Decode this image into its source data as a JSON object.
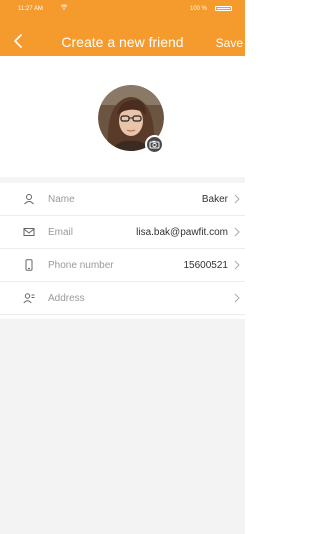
{
  "status_bar": {
    "time": "11:27 AM",
    "battery_text": "100 %"
  },
  "navbar": {
    "back_icon": "chevron-left-icon",
    "title": "Create a new friend",
    "save_label": "Save"
  },
  "avatar": {
    "camera_icon": "camera-icon"
  },
  "form": {
    "rows": [
      {
        "icon": "person-icon",
        "label": "Name",
        "value": "Baker"
      },
      {
        "icon": "mail-icon",
        "label": "Email",
        "value": "lisa.bak@pawfit.com"
      },
      {
        "icon": "phone-icon",
        "label": "Phone number",
        "value": "15600521"
      },
      {
        "icon": "address-icon",
        "label": "Address",
        "value": ""
      }
    ]
  },
  "colors": {
    "brand": "#f59a2c",
    "background": "#f3f3f3"
  }
}
